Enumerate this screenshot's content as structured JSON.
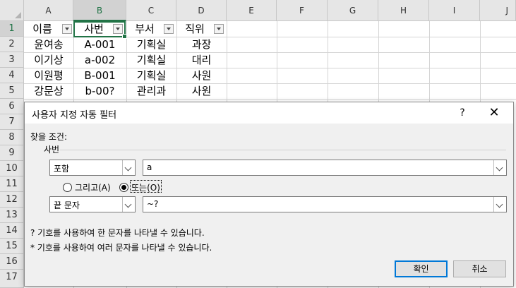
{
  "sheet": {
    "columns": [
      "A",
      "B",
      "C",
      "D",
      "E",
      "F",
      "G",
      "H",
      "I",
      "J"
    ],
    "rows": [
      "1",
      "2",
      "3",
      "4",
      "5",
      "6",
      "7",
      "8",
      "9",
      "10",
      "11",
      "12",
      "13",
      "14",
      "15",
      "16",
      "17"
    ],
    "header": [
      "이름",
      "사번",
      "부서",
      "직위"
    ],
    "data": [
      [
        "윤여송",
        "A-001",
        "기획실",
        "과장"
      ],
      [
        "이기상",
        "a-002",
        "기획실",
        "대리"
      ],
      [
        "이원평",
        "B-001",
        "기획실",
        "사원"
      ],
      [
        "강문상",
        "b-00?",
        "관리과",
        "사원"
      ]
    ]
  },
  "dialog": {
    "title": "사용자 지정 자동 필터",
    "help": "?",
    "close": "✕",
    "criteria_label": "찾을 조건:",
    "field_label": "사번",
    "cond1_operator": "포함",
    "cond1_value": "a",
    "and_label": "그리고(A)",
    "or_label": "또는(O)",
    "selected_logic": "or",
    "cond2_operator": "끝 문자",
    "cond2_value": "~?",
    "hint1": "? 기호를 사용하여 한 문자를 나타낼 수 있습니다.",
    "hint2": "* 기호를 사용하여 여러 문자를 나타낼 수 있습니다.",
    "ok": "확인",
    "cancel": "취소"
  }
}
